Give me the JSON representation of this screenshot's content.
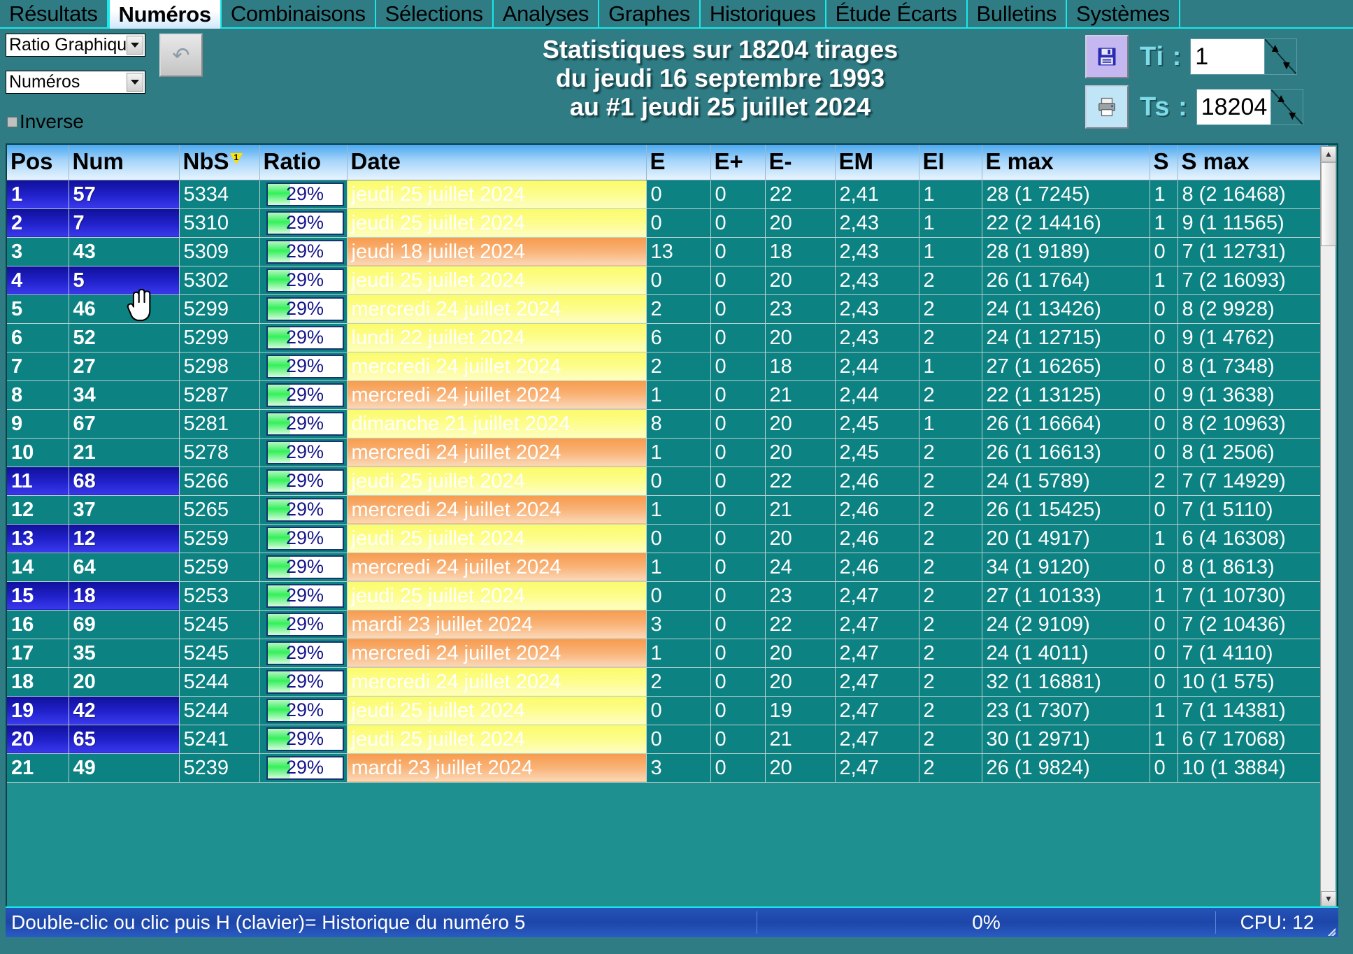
{
  "tabs": [
    {
      "label": "Résultats",
      "active": false
    },
    {
      "label": "Numéros",
      "active": true
    },
    {
      "label": "Combinaisons",
      "active": false
    },
    {
      "label": "Sélections",
      "active": false
    },
    {
      "label": "Analyses",
      "active": false
    },
    {
      "label": "Graphes",
      "active": false
    },
    {
      "label": "Historiques",
      "active": false
    },
    {
      "label": "Étude Écarts",
      "active": false
    },
    {
      "label": "Bulletins",
      "active": false
    },
    {
      "label": "Systèmes",
      "active": false
    }
  ],
  "controls": {
    "mode_combo": "Ratio Graphique",
    "target_combo": "Numéros",
    "undo_icon": "undo-arrow-icon",
    "inverse_label": "Inverse"
  },
  "title": {
    "line1": "Statistiques sur 18204 tirages",
    "line2": "du jeudi 16 septembre 1993",
    "line3": "au #1 jeudi 25 juillet 2024"
  },
  "tools": {
    "save_icon": "floppy-disk-icon",
    "print_icon": "printer-icon",
    "ti_label": "Ti :",
    "ti_value": "1",
    "ts_label": "Ts :",
    "ts_value": "18204"
  },
  "table": {
    "columns": [
      "Pos",
      "Num",
      "NbS",
      "Ratio",
      "Date",
      "E",
      "E+",
      "E-",
      "EM",
      "EI",
      "E max",
      "S",
      "S max"
    ],
    "sorted_column": "NbS",
    "sort_order": "1",
    "rows": [
      {
        "pos": "1",
        "num": "57",
        "nbs": "5334",
        "ratio": "29%",
        "date": "jeudi 25 juillet 2024",
        "date_color": "y",
        "e": "0",
        "ep": "0",
        "em_": "22",
        "em": "2,41",
        "ei": "1",
        "emax": "28  (1 7245)",
        "s": "1",
        "smax": "8  (2 16468)",
        "sel": true
      },
      {
        "pos": "2",
        "num": "7",
        "nbs": "5310",
        "ratio": "29%",
        "date": "jeudi 25 juillet 2024",
        "date_color": "y",
        "e": "0",
        "ep": "0",
        "em_": "20",
        "em": "2,43",
        "ei": "1",
        "emax": "22  (2 14416)",
        "s": "1",
        "smax": "9  (1 11565)",
        "sel": true
      },
      {
        "pos": "3",
        "num": "43",
        "nbs": "5309",
        "ratio": "29%",
        "date": "jeudi 18 juillet 2024",
        "date_color": "o",
        "e": "13",
        "ep": "0",
        "em_": "18",
        "em": "2,43",
        "ei": "1",
        "emax": "28  (1 9189)",
        "s": "0",
        "smax": "7  (1 12731)",
        "sel": false
      },
      {
        "pos": "4",
        "num": "5",
        "nbs": "5302",
        "ratio": "29%",
        "date": "jeudi 25 juillet 2024",
        "date_color": "y",
        "e": "0",
        "ep": "0",
        "em_": "20",
        "em": "2,43",
        "ei": "2",
        "emax": "26  (1 1764)",
        "s": "1",
        "smax": "7  (2 16093)",
        "sel": true
      },
      {
        "pos": "5",
        "num": "46",
        "nbs": "5299",
        "ratio": "29%",
        "date": "mercredi 24 juillet 2024",
        "date_color": "y",
        "e": "2",
        "ep": "0",
        "em_": "23",
        "em": "2,43",
        "ei": "2",
        "emax": "24  (1 13426)",
        "s": "0",
        "smax": "8  (2 9928)",
        "sel": false
      },
      {
        "pos": "6",
        "num": "52",
        "nbs": "5299",
        "ratio": "29%",
        "date": "lundi 22 juillet 2024",
        "date_color": "y",
        "e": "6",
        "ep": "0",
        "em_": "20",
        "em": "2,43",
        "ei": "2",
        "emax": "24  (1 12715)",
        "s": "0",
        "smax": "9  (1 4762)",
        "sel": false
      },
      {
        "pos": "7",
        "num": "27",
        "nbs": "5298",
        "ratio": "29%",
        "date": "mercredi 24 juillet 2024",
        "date_color": "y",
        "e": "2",
        "ep": "0",
        "em_": "18",
        "em": "2,44",
        "ei": "1",
        "emax": "27  (1 16265)",
        "s": "0",
        "smax": "8  (1 7348)",
        "sel": false
      },
      {
        "pos": "8",
        "num": "34",
        "nbs": "5287",
        "ratio": "29%",
        "date": "mercredi 24 juillet 2024",
        "date_color": "o",
        "e": "1",
        "ep": "0",
        "em_": "21",
        "em": "2,44",
        "ei": "2",
        "emax": "22  (1 13125)",
        "s": "0",
        "smax": "9  (1 3638)",
        "sel": false
      },
      {
        "pos": "9",
        "num": "67",
        "nbs": "5281",
        "ratio": "29%",
        "date": "dimanche 21 juillet 2024",
        "date_color": "y",
        "e": "8",
        "ep": "0",
        "em_": "20",
        "em": "2,45",
        "ei": "1",
        "emax": "26  (1 16664)",
        "s": "0",
        "smax": "8  (2 10963)",
        "sel": false
      },
      {
        "pos": "10",
        "num": "21",
        "nbs": "5278",
        "ratio": "29%",
        "date": "mercredi 24 juillet 2024",
        "date_color": "o",
        "e": "1",
        "ep": "0",
        "em_": "20",
        "em": "2,45",
        "ei": "2",
        "emax": "26  (1 16613)",
        "s": "0",
        "smax": "8  (1 2506)",
        "sel": false
      },
      {
        "pos": "11",
        "num": "68",
        "nbs": "5266",
        "ratio": "29%",
        "date": "jeudi 25 juillet 2024",
        "date_color": "y",
        "e": "0",
        "ep": "0",
        "em_": "22",
        "em": "2,46",
        "ei": "2",
        "emax": "24  (1 5789)",
        "s": "2",
        "smax": "7  (7 14929)",
        "sel": true
      },
      {
        "pos": "12",
        "num": "37",
        "nbs": "5265",
        "ratio": "29%",
        "date": "mercredi 24 juillet 2024",
        "date_color": "o",
        "e": "1",
        "ep": "0",
        "em_": "21",
        "em": "2,46",
        "ei": "2",
        "emax": "26  (1 15425)",
        "s": "0",
        "smax": "7  (1 5110)",
        "sel": false
      },
      {
        "pos": "13",
        "num": "12",
        "nbs": "5259",
        "ratio": "29%",
        "date": "jeudi 25 juillet 2024",
        "date_color": "y",
        "e": "0",
        "ep": "0",
        "em_": "20",
        "em": "2,46",
        "ei": "2",
        "emax": "20  (1 4917)",
        "s": "1",
        "smax": "6  (4 16308)",
        "sel": true
      },
      {
        "pos": "14",
        "num": "64",
        "nbs": "5259",
        "ratio": "29%",
        "date": "mercredi 24 juillet 2024",
        "date_color": "o",
        "e": "1",
        "ep": "0",
        "em_": "24",
        "em": "2,46",
        "ei": "2",
        "emax": "34  (1 9120)",
        "s": "0",
        "smax": "8  (1 8613)",
        "sel": false
      },
      {
        "pos": "15",
        "num": "18",
        "nbs": "5253",
        "ratio": "29%",
        "date": "jeudi 25 juillet 2024",
        "date_color": "y",
        "e": "0",
        "ep": "0",
        "em_": "23",
        "em": "2,47",
        "ei": "2",
        "emax": "27  (1 10133)",
        "s": "1",
        "smax": "7  (1 10730)",
        "sel": true
      },
      {
        "pos": "16",
        "num": "69",
        "nbs": "5245",
        "ratio": "29%",
        "date": "mardi 23 juillet 2024",
        "date_color": "o",
        "e": "3",
        "ep": "0",
        "em_": "22",
        "em": "2,47",
        "ei": "2",
        "emax": "24  (2 9109)",
        "s": "0",
        "smax": "7  (2 10436)",
        "sel": false
      },
      {
        "pos": "17",
        "num": "35",
        "nbs": "5245",
        "ratio": "29%",
        "date": "mercredi 24 juillet 2024",
        "date_color": "o",
        "e": "1",
        "ep": "0",
        "em_": "20",
        "em": "2,47",
        "ei": "2",
        "emax": "24  (1 4011)",
        "s": "0",
        "smax": "7  (1 4110)",
        "sel": false
      },
      {
        "pos": "18",
        "num": "20",
        "nbs": "5244",
        "ratio": "29%",
        "date": "mercredi 24 juillet 2024",
        "date_color": "y",
        "e": "2",
        "ep": "0",
        "em_": "20",
        "em": "2,47",
        "ei": "2",
        "emax": "32  (1 16881)",
        "s": "0",
        "smax": "10  (1 575)",
        "sel": false
      },
      {
        "pos": "19",
        "num": "42",
        "nbs": "5244",
        "ratio": "29%",
        "date": "jeudi 25 juillet 2024",
        "date_color": "y",
        "e": "0",
        "ep": "0",
        "em_": "19",
        "em": "2,47",
        "ei": "2",
        "emax": "23  (1 7307)",
        "s": "1",
        "smax": "7  (1 14381)",
        "sel": true
      },
      {
        "pos": "20",
        "num": "65",
        "nbs": "5241",
        "ratio": "29%",
        "date": "jeudi 25 juillet 2024",
        "date_color": "y",
        "e": "0",
        "ep": "0",
        "em_": "21",
        "em": "2,47",
        "ei": "2",
        "emax": "30  (1 2971)",
        "s": "1",
        "smax": "6  (7 17068)",
        "sel": true
      },
      {
        "pos": "21",
        "num": "49",
        "nbs": "5239",
        "ratio": "29%",
        "date": "mardi 23 juillet 2024",
        "date_color": "o",
        "e": "3",
        "ep": "0",
        "em_": "20",
        "em": "2,47",
        "ei": "2",
        "emax": "26  (1 9824)",
        "s": "0",
        "smax": "10  (1 3884)",
        "sel": false
      }
    ]
  },
  "status": {
    "message": "Double-clic ou clic puis H (clavier)= Historique du numéro 5",
    "progress": "0%",
    "cpu": "CPU: 12"
  },
  "colors": {
    "teal_bg": "#2f7c85",
    "cell_teal": "#0d8282",
    "accent_cyan": "#19e8e8",
    "selected_blue": "#2222cc",
    "date_yellow": "#fdfd8c",
    "date_orange": "#f9b377",
    "status_blue": "#1d46a8",
    "ratio_green": "#34f05a"
  }
}
